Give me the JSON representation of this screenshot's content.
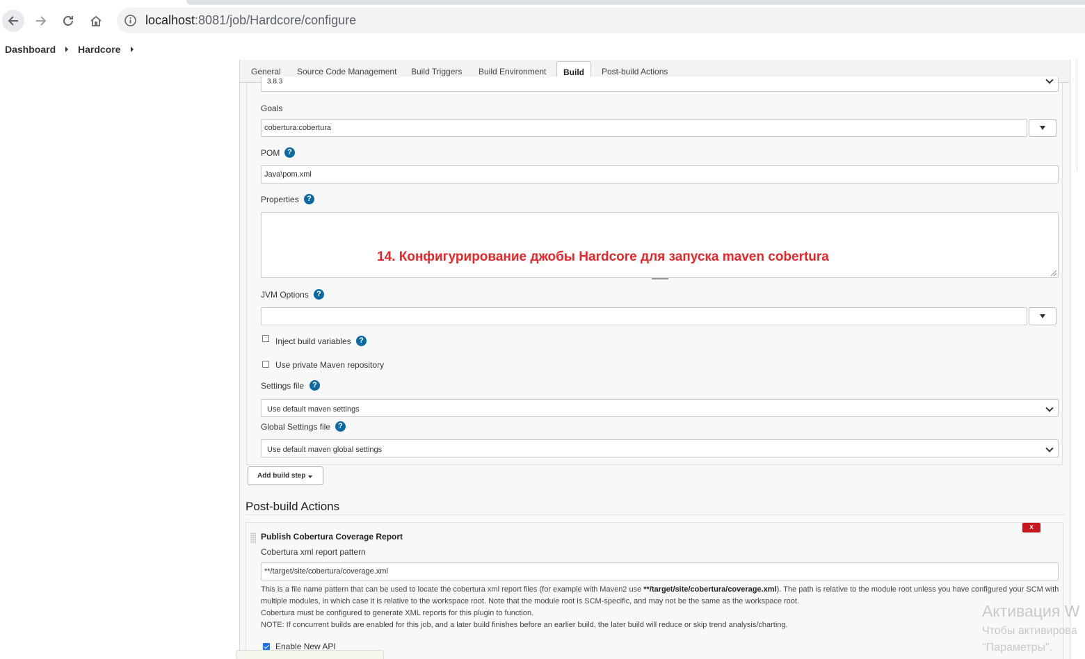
{
  "browser": {
    "url_host": "localhost",
    "url_path": ":8081/job/Hardcore/configure"
  },
  "breadcrumb": {
    "items": [
      "Dashboard",
      "Hardcore"
    ]
  },
  "tabs": [
    {
      "label": "General"
    },
    {
      "label": "Source Code Management"
    },
    {
      "label": "Build Triggers"
    },
    {
      "label": "Build Environment"
    },
    {
      "label": "Build"
    },
    {
      "label": "Post-build Actions"
    }
  ],
  "build": {
    "maven_version_value": "3.8.3",
    "goals_label": "Goals",
    "goals_value": "cobertura:cobertura",
    "pom_label": "POM",
    "pom_value": "Java\\pom.xml",
    "properties_label": "Properties",
    "annotation": "14. Конфигурирование джобы Hardcore для запуска maven cobertura",
    "jvm_label": "JVM Options",
    "jvm_value": "",
    "inject_label": "Inject build variables",
    "private_repo_label": "Use private Maven repository",
    "settings_label": "Settings file",
    "settings_value": "Use default maven settings",
    "global_settings_label": "Global Settings file",
    "global_settings_value": "Use default maven global settings",
    "add_step_label": "Add build step"
  },
  "post_build": {
    "title": "Post-build Actions",
    "publisher_title": "Publish Cobertura Coverage Report",
    "delete_label": "x",
    "pattern_label": "Cobertura xml report pattern",
    "pattern_value": "**/target/site/cobertura/coverage.xml",
    "desc_part1": "This is a file name pattern that can be used to locate the cobertura xml report files (for example with Maven2 use ",
    "desc_bold": "**/target/site/cobertura/coverage.xml",
    "desc_part2": "). The path is relative to the module root unless you have configured your SCM with multiple modules, in which case it is relative to the workspace root. Note that the module root is SCM-specific, and may not be the same as the workspace root.",
    "desc_line2": "Cobertura must be configured to generate XML reports for this plugin to function.",
    "desc_line3": "NOTE: If concurrent builds are enabled for this job, and a later build finishes before an earlier build, the later build will reduce or skip trend analysis/charting.",
    "enable_api_label": "Enable New API",
    "enable_api_checked": true
  },
  "watermark": {
    "title": "Активация W",
    "line1": "Чтобы активирова",
    "line2": "\"Параметры\"."
  },
  "colors": {
    "annotation": "#e8262a",
    "help_icon": "#0b6aa2",
    "delete_button": "#c9171e"
  }
}
